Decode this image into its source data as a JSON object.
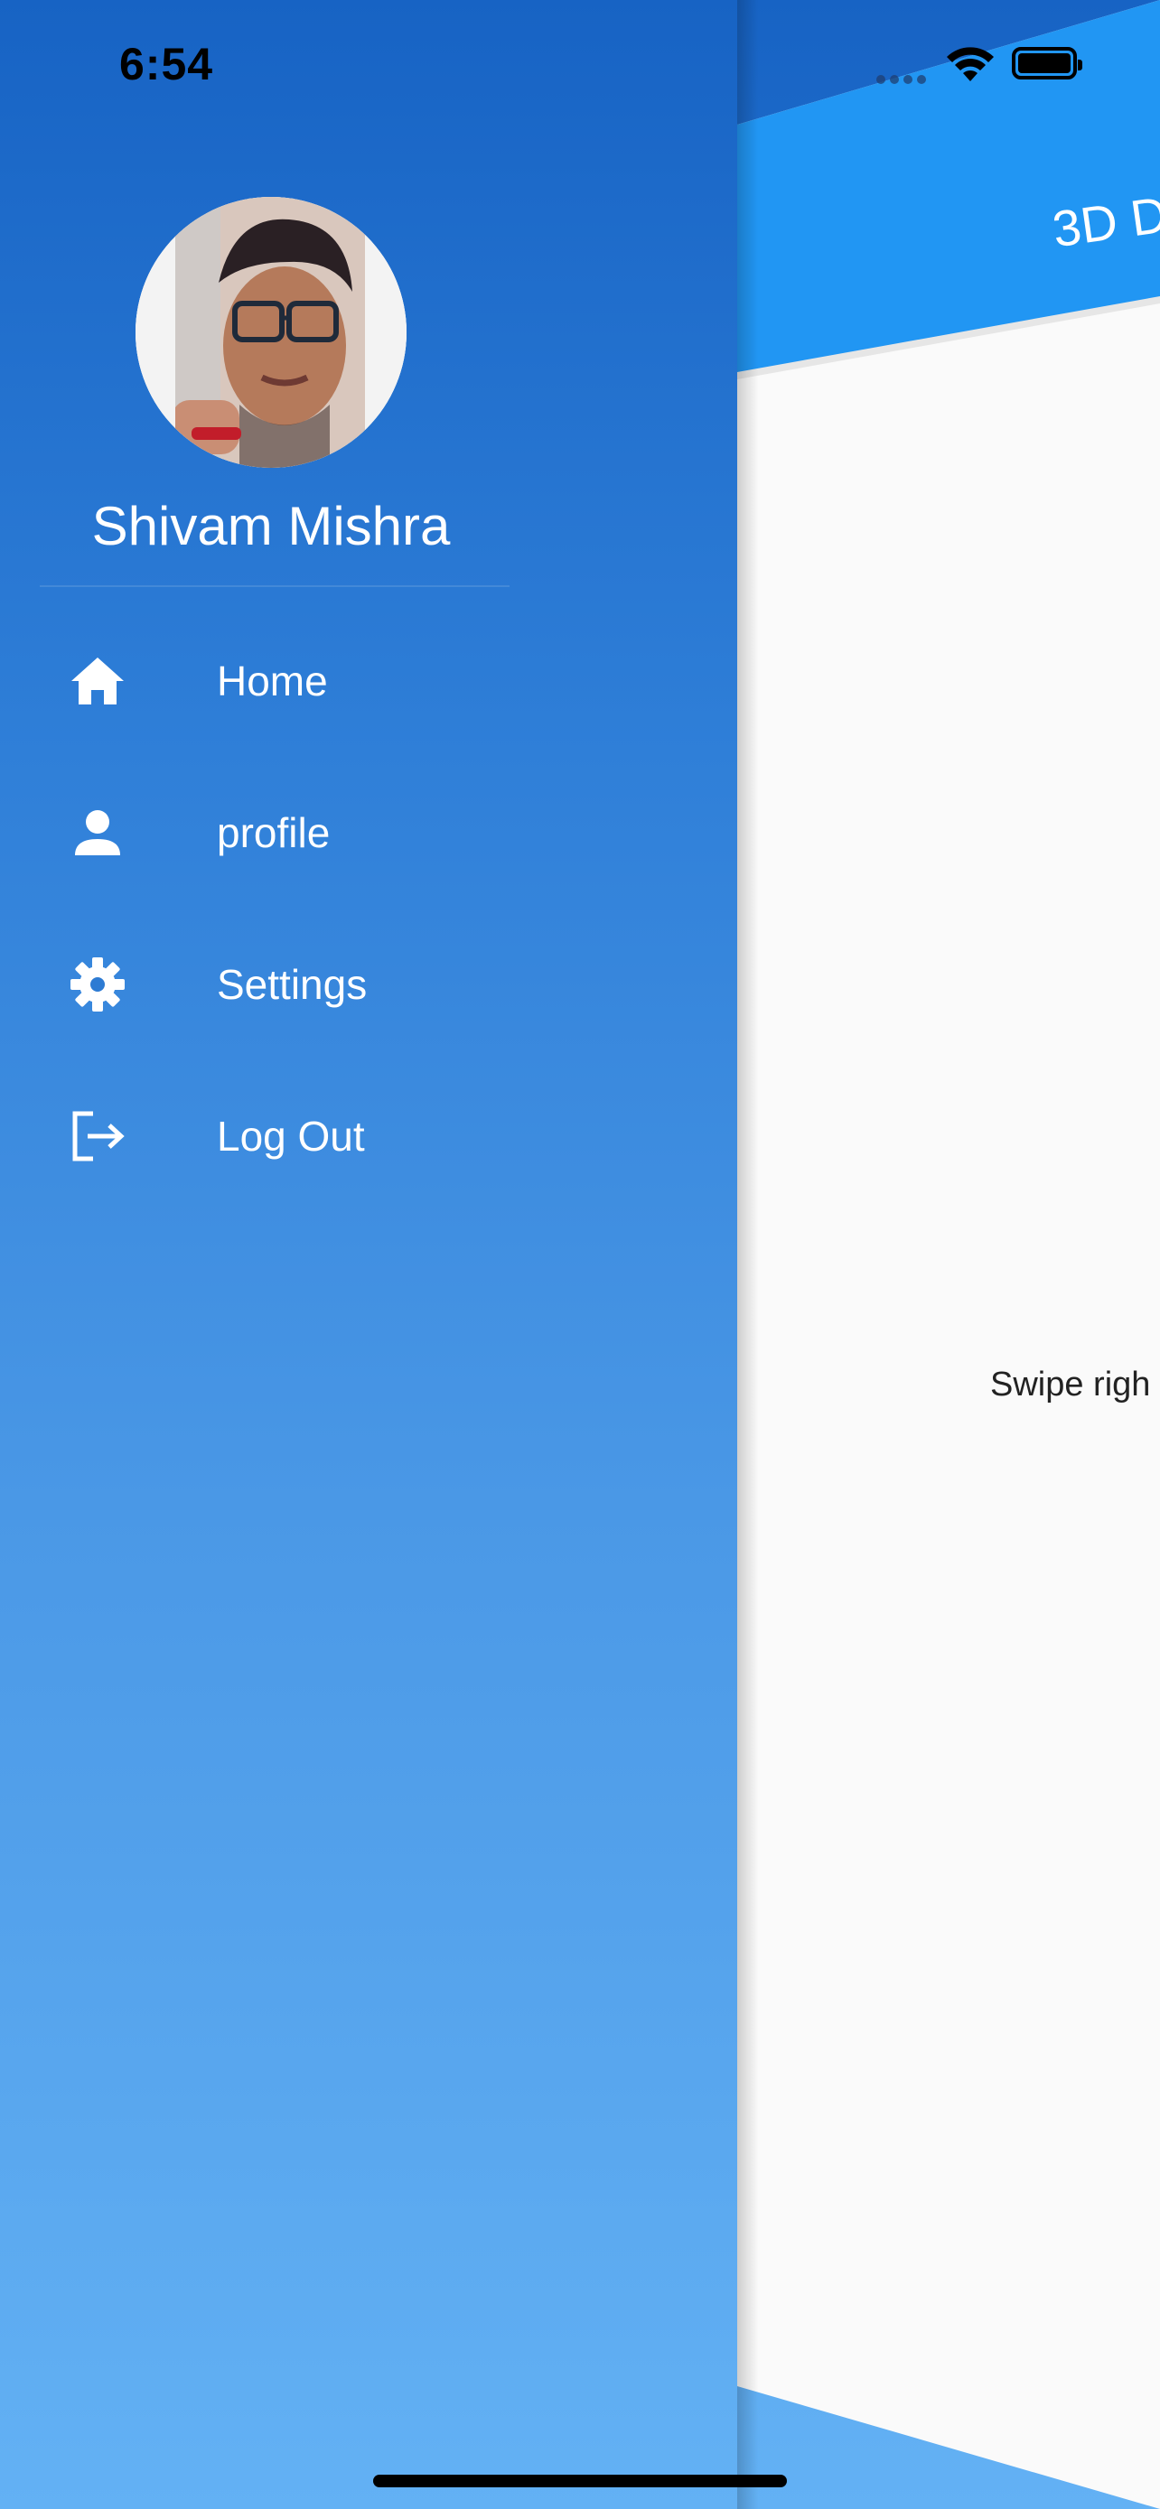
{
  "status_bar": {
    "time": "6:54"
  },
  "drawer": {
    "user_name": "Shivam Mishra",
    "items": [
      {
        "label": "Home",
        "icon": "home-icon"
      },
      {
        "label": "profile",
        "icon": "person-icon"
      },
      {
        "label": "Settings",
        "icon": "gear-icon"
      },
      {
        "label": "Log Out",
        "icon": "logout-icon"
      }
    ]
  },
  "main": {
    "title": "3D D",
    "body_text": "Swipe righ"
  },
  "colors": {
    "gradient_top": "#1763c4",
    "gradient_bottom": "#63b1f4",
    "appbar": "#2196f3",
    "page_bg": "#fafafa"
  }
}
